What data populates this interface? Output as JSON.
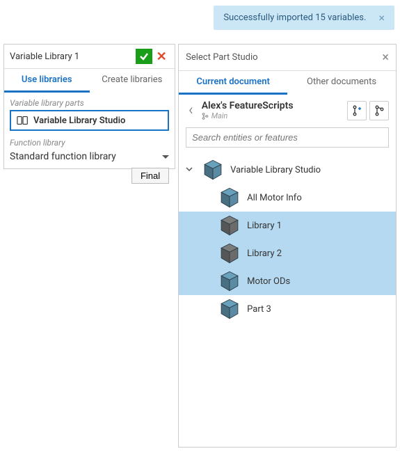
{
  "toast": {
    "message": "Successfully imported 15 variables.",
    "close_aria": "Dismiss"
  },
  "left_panel": {
    "title": "Variable Library 1",
    "tabs": {
      "use": "Use libraries",
      "create": "Create libraries"
    },
    "parts_label": "Variable library parts",
    "studio_name": "Variable Library Studio",
    "function_label": "Function library",
    "function_value": "Standard function library",
    "final_button": "Final"
  },
  "right_panel": {
    "title": "Select Part Studio",
    "tabs": {
      "current": "Current document",
      "other": "Other documents"
    },
    "breadcrumb": {
      "doc_name": "Alex's FeatureScripts",
      "workspace": "Main"
    },
    "search_placeholder": "Search entities or features",
    "tree": {
      "root": "Variable Library Studio",
      "children": [
        {
          "label": "All Motor Info",
          "selected": false,
          "darkCube": false
        },
        {
          "label": "Library 1",
          "selected": true,
          "darkCube": true
        },
        {
          "label": "Library 2",
          "selected": true,
          "darkCube": true
        },
        {
          "label": "Motor ODs",
          "selected": true,
          "darkCube": false
        },
        {
          "label": "Part 3",
          "selected": false,
          "darkCube": false
        }
      ]
    }
  },
  "colors": {
    "cube_light": "#5b8ba3",
    "cube_dark": "#6b6b6b"
  }
}
